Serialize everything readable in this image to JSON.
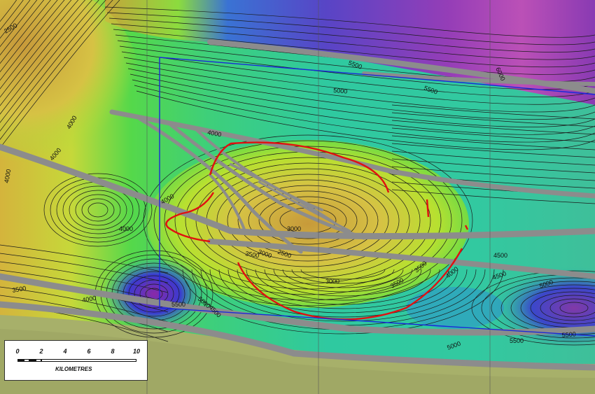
{
  "map": {
    "contour_labels": [
      {
        "id": "c2500-tl",
        "text": "2500"
      },
      {
        "id": "c4000-a",
        "text": "4000"
      },
      {
        "id": "c4000-b",
        "text": "4000"
      },
      {
        "id": "c4000-c",
        "text": "4000"
      },
      {
        "id": "c4000-d",
        "text": "4000"
      },
      {
        "id": "c4000-e",
        "text": "4000"
      },
      {
        "id": "c4000-f",
        "text": "4000"
      },
      {
        "id": "c4000-g",
        "text": "4000"
      },
      {
        "id": "c4000-h",
        "text": "4000"
      },
      {
        "id": "c3000-a",
        "text": "3000"
      },
      {
        "id": "c3000-b",
        "text": "3000"
      },
      {
        "id": "c3000-c",
        "text": "3000"
      },
      {
        "id": "c3500-a",
        "text": "3500"
      },
      {
        "id": "c3500-b",
        "text": "3500"
      },
      {
        "id": "c3500-c",
        "text": "3500"
      },
      {
        "id": "c3500-d",
        "text": "3500"
      },
      {
        "id": "c2500-m",
        "text": "2500"
      },
      {
        "id": "c4500-a",
        "text": "4500"
      },
      {
        "id": "c4500-b",
        "text": "4500"
      },
      {
        "id": "c4500-c",
        "text": "4500"
      },
      {
        "id": "c5000-a",
        "text": "5000"
      },
      {
        "id": "c5000-b",
        "text": "5000"
      },
      {
        "id": "c5000-c",
        "text": "5000"
      },
      {
        "id": "c5000-d",
        "text": "5000"
      },
      {
        "id": "c5500-a",
        "text": "5500"
      },
      {
        "id": "c5500-b",
        "text": "5500"
      },
      {
        "id": "c5500-c",
        "text": "5500"
      },
      {
        "id": "c5500-d",
        "text": "5500"
      },
      {
        "id": "c5500-e",
        "text": "5500"
      },
      {
        "id": "c6000",
        "text": "6000"
      }
    ],
    "colors": {
      "deep": "#8a2aa8",
      "blue": "#3a3ad0",
      "teal": "#2fc9a0",
      "green": "#5ee04a",
      "lime": "#b8e030",
      "yellow": "#d8c040",
      "ochre": "#c7a23a",
      "fault": "#8c8c8c",
      "closure": "#e01010",
      "survey": "#1a2ad8",
      "basement": "#a7b06a"
    }
  },
  "scale_bar": {
    "ticks": [
      "0",
      "2",
      "4",
      "6",
      "8",
      "10"
    ],
    "units": "KILOMETRES"
  }
}
